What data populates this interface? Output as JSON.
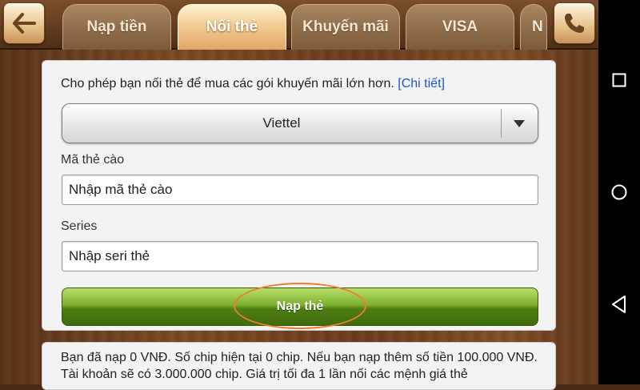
{
  "header": {
    "tabs": [
      {
        "label": "Nạp tiền",
        "active": false
      },
      {
        "label": "Nối thẻ",
        "active": true
      },
      {
        "label": "Khuyến mãi",
        "active": false
      },
      {
        "label": "VISA",
        "active": false
      },
      {
        "label": "N",
        "active": false
      }
    ],
    "back_icon": "back-arrow-icon",
    "phone_icon": "phone-icon"
  },
  "form": {
    "intro_text": "Cho phép bạn nối thẻ để mua các gói khuyến mãi lớn hơn.",
    "details_link": "[Chi tiết]",
    "carrier": {
      "selected": "Viettel"
    },
    "card_code": {
      "label": "Mã thẻ cào",
      "placeholder": "Nhập mã thẻ cào",
      "value": ""
    },
    "serial": {
      "label": "Series",
      "placeholder": "Nhập seri thẻ",
      "value": ""
    },
    "submit_label": "Nạp thẻ"
  },
  "note": {
    "text": "Bạn đã nạp 0 VNĐ. Số chip hiện tại 0 chip. Nếu bạn nạp thêm số tiền 100.000 VNĐ. Tài khoản sẽ có 3.000.000 chip. Giá trị tối đa 1 lần nối các mệnh giá thẻ"
  },
  "system_nav": {
    "icons": [
      "recents-square-icon",
      "home-circle-icon",
      "back-triangle-icon"
    ]
  },
  "colors": {
    "accent_orange": "#f07d2a",
    "submit_green": "#5e9a1e",
    "link_blue": "#1a56c9"
  }
}
